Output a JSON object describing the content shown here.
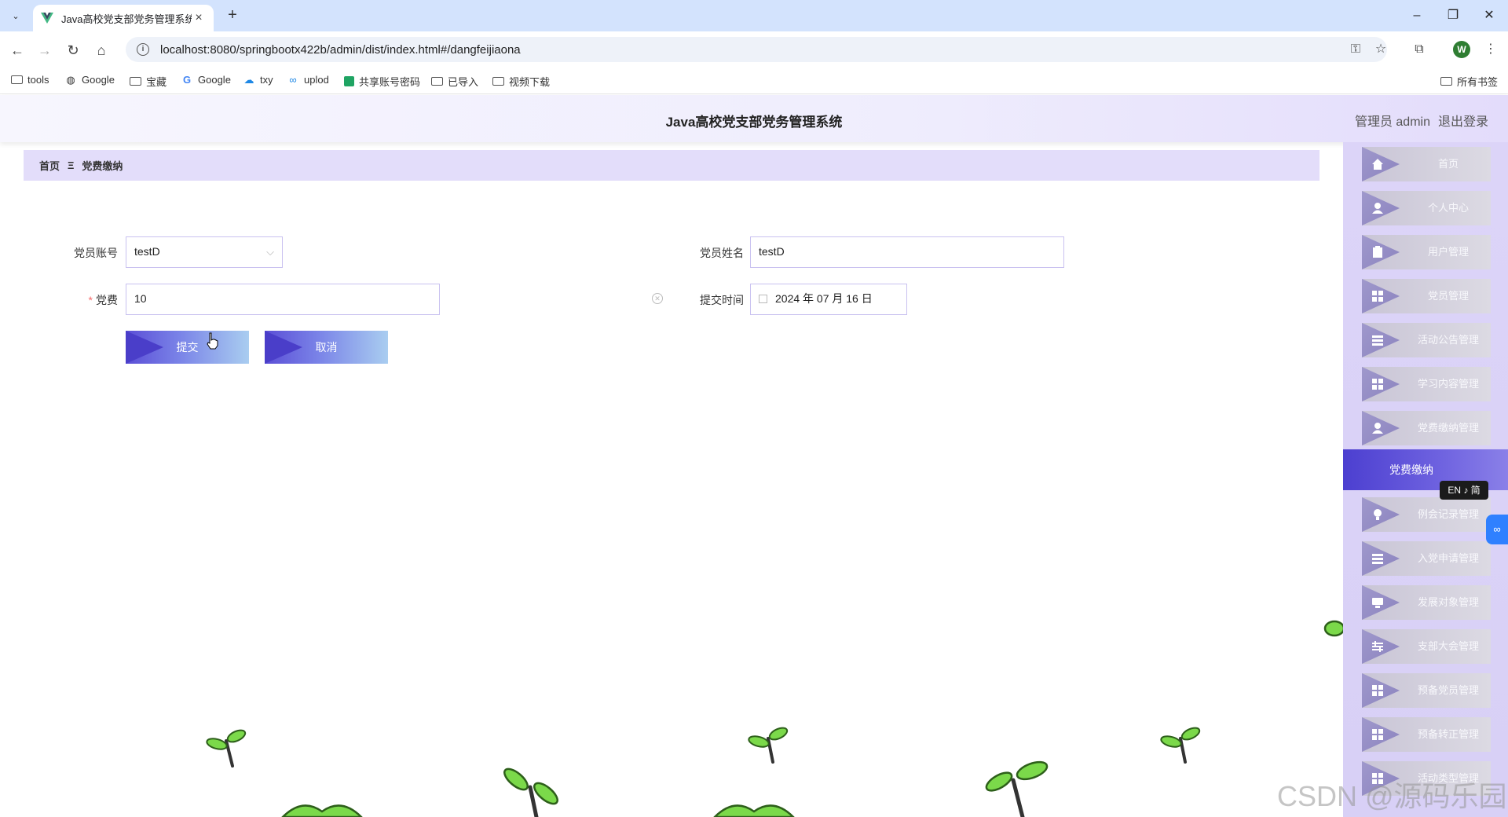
{
  "browser": {
    "tab_title": "Java高校党支部党务管理系统",
    "url": "localhost:8080/springbootx422b/admin/dist/index.html#/dangfeijiaona",
    "profile_initial": "W",
    "bookmarks": [
      "tools",
      "Google",
      "宝藏",
      "Google",
      "txy",
      "uplod",
      "共享账号密码",
      "已导入",
      "视频下载"
    ],
    "all_bookmarks": "所有书签"
  },
  "header": {
    "title": "Java高校党支部党务管理系统",
    "user": "管理员 admin",
    "logout": "退出登录"
  },
  "breadcrumb": {
    "home": "首页",
    "separator": "Ξ",
    "current": "党费缴纳"
  },
  "form": {
    "account_label": "党员账号",
    "account_value": "testD",
    "name_label": "党员姓名",
    "name_value": "testD",
    "fee_required": "*",
    "fee_label": "党费",
    "fee_value": "10",
    "time_label": "提交时间",
    "time_value": "2024 年 07 月 16 日",
    "submit": "提交",
    "cancel": "取消"
  },
  "sidebar": {
    "items": [
      {
        "label": "首页",
        "icon": "home-icon"
      },
      {
        "label": "个人中心",
        "icon": "user-icon"
      },
      {
        "label": "用户管理",
        "icon": "clipboard-icon"
      },
      {
        "label": "党员管理",
        "icon": "grid-icon"
      },
      {
        "label": "活动公告管理",
        "icon": "list-icon"
      },
      {
        "label": "学习内容管理",
        "icon": "grid-icon"
      },
      {
        "label": "党费缴纳管理",
        "icon": "user-icon"
      },
      {
        "label": "例会记录管理",
        "icon": "bulb-icon"
      },
      {
        "label": "入党申请管理",
        "icon": "list-icon"
      },
      {
        "label": "发展对象管理",
        "icon": "monitor-icon"
      },
      {
        "label": "支部大会管理",
        "icon": "sliders-icon"
      },
      {
        "label": "预备党员管理",
        "icon": "grid-icon"
      },
      {
        "label": "预备转正管理",
        "icon": "grid-icon"
      },
      {
        "label": "活动类型管理",
        "icon": "grid-icon"
      }
    ],
    "active": "党费缴纳"
  },
  "overlay": {
    "lang": "EN ♪ 简",
    "watermark": "CSDN @源码乐园"
  }
}
